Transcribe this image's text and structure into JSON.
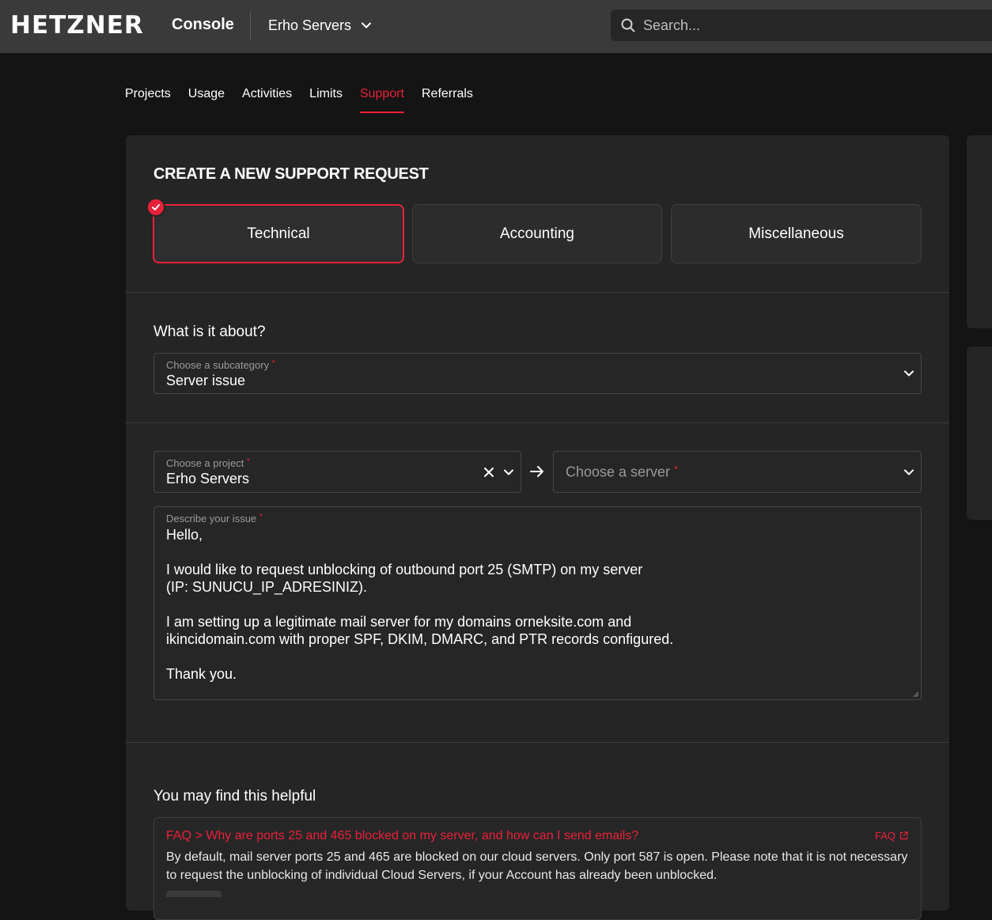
{
  "topbar": {
    "logo": "HETZNER",
    "console": "Console",
    "project_selector": "Erho Servers",
    "search_placeholder": "Search..."
  },
  "nav": {
    "tabs": [
      "Projects",
      "Usage",
      "Activities",
      "Limits",
      "Support",
      "Referrals"
    ],
    "active": "Support"
  },
  "form": {
    "title": "CREATE A NEW SUPPORT REQUEST",
    "types": [
      "Technical",
      "Accounting",
      "Miscellaneous"
    ],
    "selected_type": "Technical",
    "about_heading": "What is it about?",
    "subcategory": {
      "label": "Choose a subcategory",
      "value": "Server issue"
    },
    "project": {
      "label": "Choose a project",
      "value": "Erho Servers"
    },
    "server": {
      "placeholder": "Choose a server"
    },
    "issue": {
      "label": "Describe your issue",
      "value": "Hello,\n\nI would like to request unblocking of outbound port 25 (SMTP) on my server\n(IP: SUNUCU_IP_ADRESINIZ).\n\nI am setting up a legitimate mail server for my domains orneksite.com and\nikincidomain.com with proper SPF, DKIM, DMARC, and PTR records configured.\n\nThank you."
    },
    "required_mark": "*"
  },
  "helpful": {
    "heading": "You may find this helpful",
    "items": [
      {
        "title": "FAQ > Why are ports 25 and 465 blocked on my server, and how can I send emails?",
        "badge": "FAQ",
        "text": "By default, mail server ports 25 and 465 are blocked on our cloud servers. Only port 587 is open. Please note that it is not necessary to request the unblocking of individual Cloud Servers, if your Account has already been unblocked."
      }
    ]
  },
  "colors": {
    "accent": "#e8213a",
    "topbar": "#3a3a3a",
    "background": "#141414",
    "card": "#252525"
  }
}
